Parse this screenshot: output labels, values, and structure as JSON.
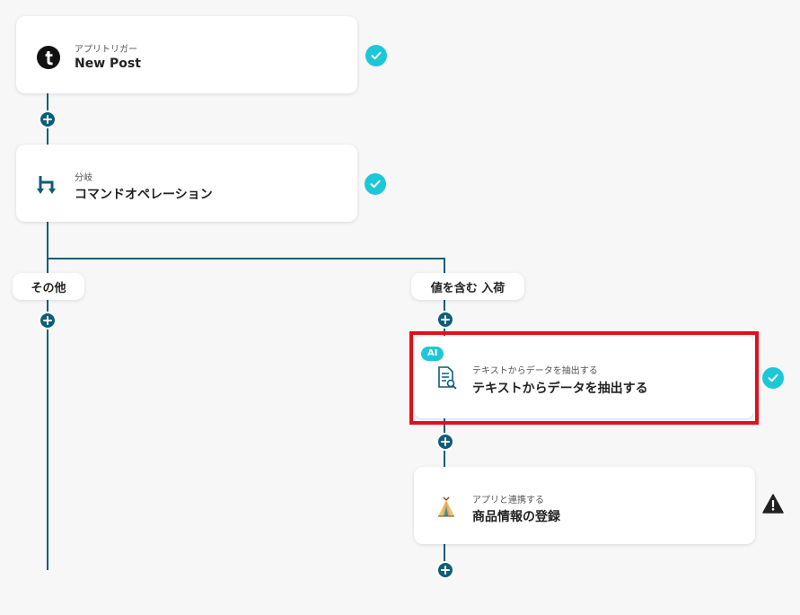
{
  "steps": [
    {
      "sub": "アプリトリガー",
      "title": "New Post",
      "icon": "tumblr-icon",
      "status": "complete"
    },
    {
      "sub": "分岐",
      "title": "コマンドオペレーション",
      "icon": "branch-icon",
      "status": "complete"
    },
    {
      "sub": "テキストからデータを抽出する",
      "title": "テキストからデータを抽出する",
      "icon": "document-search-icon",
      "status": "complete",
      "badge": "AI"
    },
    {
      "sub": "アプリと連携する",
      "title": "商品情報の登録",
      "icon": "tent-app-icon",
      "status": "warning"
    }
  ],
  "branches": {
    "left_label": "その他",
    "right_label": "値を含む 入荷"
  },
  "colors": {
    "line": "#0f5d78",
    "check": "#1ec7d8",
    "highlight": "#e0101b",
    "warning": "#222222"
  }
}
